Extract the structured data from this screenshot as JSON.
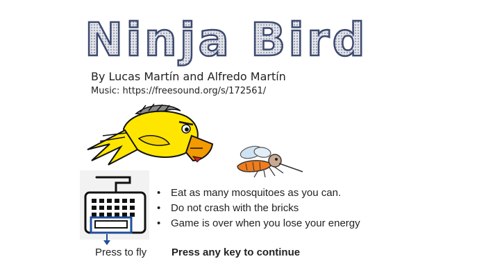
{
  "game": {
    "title": "Ninja Bird",
    "credits": "By Lucas Martín and Alfredo Martín",
    "music": "Music: https://freesound.org/s/172561/",
    "rules": [
      "Eat as many mosquitoes as you can.",
      "Do not crash with the bricks",
      "Game is over when you lose your energy"
    ],
    "press_to_fly": "Press to fly",
    "press_any_key": "Press any key to continue"
  },
  "sprites": {
    "bird": "yellow-ninja-bird",
    "mosquito": "mosquito",
    "keyboard": "keyboard-icon",
    "spacebar_arrow": "down-arrow-icon"
  },
  "colors": {
    "bird_body": "#ffe600",
    "beak": "#f29a00",
    "highlight": "#1f4f9a",
    "title_outline": "#3d4a6e"
  }
}
